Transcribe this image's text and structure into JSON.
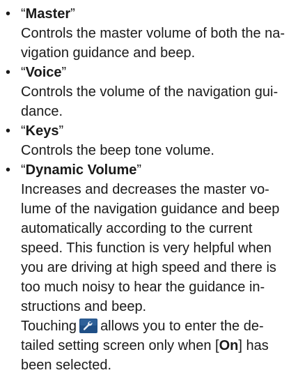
{
  "header_fragment": "",
  "items": [
    {
      "open_quote": "“",
      "term": "Master",
      "close_quote": "”",
      "desc_lines": [
        "Controls the master volume of both the na-",
        "vigation guidance and beep."
      ]
    },
    {
      "open_quote": "“",
      "term": "Voice",
      "close_quote": "”",
      "desc_lines": [
        "Controls the volume of the navigation gui-",
        "dance."
      ]
    },
    {
      "open_quote": "“",
      "term": "Keys",
      "close_quote": "”",
      "desc_lines": [
        "Controls the beep tone volume."
      ]
    },
    {
      "open_quote": "“",
      "term": "Dynamic Volume",
      "close_quote": "”",
      "desc_lines": [
        "Increases and decreases the master vo-",
        "lume of the navigation guidance and beep",
        "automatically according to the current",
        "speed. This function is very helpful when",
        "you are driving at high speed and there is",
        "too much noisy to hear the guidance in-",
        "structions and beep."
      ],
      "note": {
        "before_icon": "Touching",
        "after_icon": "allows you to enter the de-",
        "line2_before": "tailed setting screen only when [",
        "line2_bold": "On",
        "line2_after": "] has",
        "line3": "been selected.",
        "icon": "wrench-settings-icon",
        "icon_bg": "#1f4f86",
        "icon_fg": "#e8eef5"
      }
    }
  ]
}
